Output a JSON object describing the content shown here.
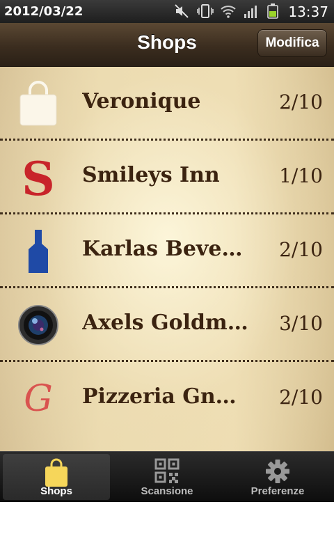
{
  "status_bar": {
    "date": "2012/03/22",
    "time": "13:37",
    "icons": [
      "mute-icon",
      "vibrate-icon",
      "wifi-icon",
      "signal-icon",
      "battery-icon"
    ]
  },
  "nav": {
    "title": "Shops",
    "edit_label": "Modifica"
  },
  "shops": [
    {
      "name": "Veronique",
      "count": "2/10",
      "logo": "shopping-bag-icon"
    },
    {
      "name": "Smileys Inn",
      "count": "1/10",
      "logo": "letter-s-logo"
    },
    {
      "name": "Karlas Bever…",
      "count": "2/10",
      "logo": "bottle-logo"
    },
    {
      "name": "Axels Goldm…",
      "count": "3/10",
      "logo": "camera-lens-logo"
    },
    {
      "name": "Pizzeria Gno…",
      "count": "2/10",
      "logo": "letter-g-logo"
    }
  ],
  "tabs": [
    {
      "label": "Shops",
      "icon": "shopping-bag-icon",
      "active": true
    },
    {
      "label": "Scansione",
      "icon": "qr-code-icon",
      "active": false
    },
    {
      "label": "Preferenze",
      "icon": "gear-icon",
      "active": false
    }
  ],
  "colors": {
    "nav_background": "#3b2d1f",
    "list_background": "#eddcb1",
    "text_brown": "#3b2310",
    "logo_red": "#c8242a",
    "logo_blue": "#1f4aa6",
    "active_tab_icon": "#f6d65a"
  }
}
